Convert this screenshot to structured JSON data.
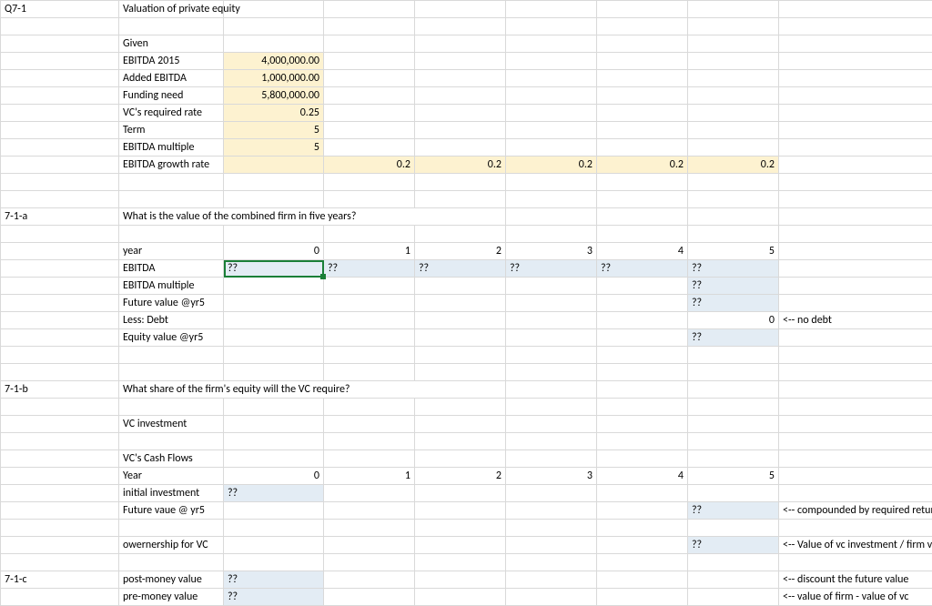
{
  "header": {
    "q": "Q7-1",
    "title": "Valuation of private equity"
  },
  "given": {
    "label": "Given",
    "ebitda2015_l": "EBITDA 2015",
    "ebitda2015_v": "4,000,000.00",
    "added_l": "Added EBITDA",
    "added_v": "1,000,000.00",
    "funding_l": "Funding need",
    "funding_v": "5,800,000.00",
    "rate_l": "VC's required rate",
    "rate_v": "0.25",
    "term_l": "Term",
    "term_v": "5",
    "mult_l": "EBITDA multiple",
    "mult_v": "5",
    "growth_l": "EBITDA growth rate",
    "g1": "0.2",
    "g2": "0.2",
    "g3": "0.2",
    "g4": "0.2",
    "g5": "0.2"
  },
  "part_a": {
    "id": "7-1-a",
    "q": "What is the value of the combined firm in five years?",
    "year_l": "year",
    "y0": "0",
    "y1": "1",
    "y2": "2",
    "y3": "3",
    "y4": "4",
    "y5": "5",
    "ebitda_l": "EBITDA",
    "e0": "??",
    "e1": "??",
    "e2": "??",
    "e3": "??",
    "e4": "??",
    "e5": "??",
    "mult_l": "EBITDA multiple",
    "mult5": "??",
    "fv_l": "Future value @yr5",
    "fv5": "??",
    "debt_l": "Less: Debt",
    "debt5": "0",
    "debt_note": "<-- no debt",
    "eq_l": "Equity value @yr5",
    "eq5": "??"
  },
  "part_b": {
    "id": "7-1-b",
    "q": "What share of the firm's equity will the VC require?",
    "vcinv_l": "VC investment",
    "cashflows_l": "VC's Cash Flows",
    "year_l": "Year",
    "y0": "0",
    "y1": "1",
    "y2": "2",
    "y3": "3",
    "y4": "4",
    "y5": "5",
    "init_l": "initial investment",
    "init0": "??",
    "fv_l": "Future vaue @ yr5",
    "fv5": "??",
    "fv_note": "<-- compounded by required return",
    "own_l": "owernership for VC",
    "own5": "??",
    "own_note": "<-- Value of vc investment / firm value"
  },
  "part_c": {
    "id": "7-1-c",
    "post_l": "post-money value",
    "post_v": "??",
    "post_note": "<-- discount the future value",
    "pre_l": "pre-money value",
    "pre_v": "??",
    "pre_note": "<-- value of firm - value of vc"
  }
}
